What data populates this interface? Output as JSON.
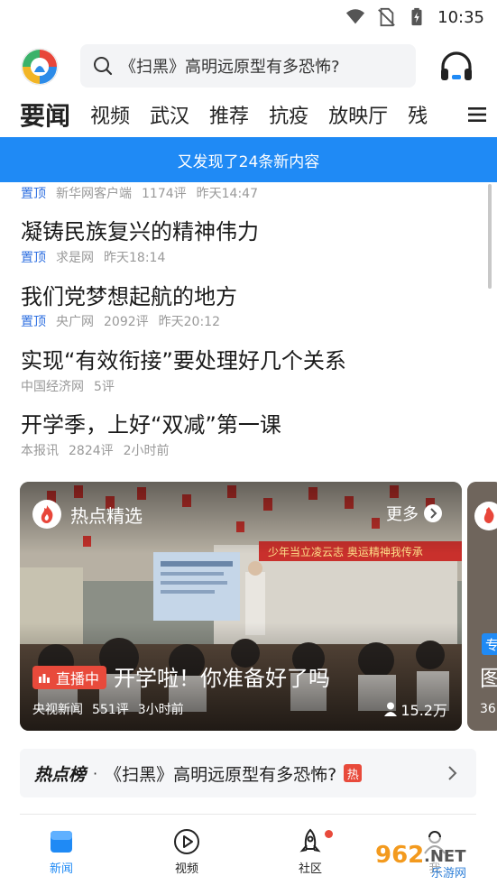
{
  "status_bar": {
    "time": "10:35"
  },
  "header": {
    "search_placeholder": "《扫黑》高明远原型有多恐怖?"
  },
  "channels": [
    "要闻",
    "视频",
    "武汉",
    "推荐",
    "抗疫",
    "放映厅",
    "残"
  ],
  "banner": {
    "text": "又发现了24条新内容"
  },
  "feed": {
    "top_meta": {
      "pin": "置顶",
      "source": "新华网客户端",
      "comments": "1174评",
      "time": "昨天14:47"
    },
    "items": [
      {
        "title": "凝铸民族复兴的精神伟力",
        "pin": "置顶",
        "source": "求是网",
        "comments": "",
        "time": "昨天18:14"
      },
      {
        "title": "我们党梦想起航的地方",
        "pin": "置顶",
        "source": "央广网",
        "comments": "2092评",
        "time": "昨天20:12"
      },
      {
        "title": "实现“有效衔接”要处理好几个关系",
        "pin": "",
        "source": "中国经济网",
        "comments": "5评",
        "time": ""
      },
      {
        "title": "开学季，上好“双减”第一课",
        "pin": "",
        "source": "本报讯",
        "comments": "2824评",
        "time": "2小时前"
      }
    ]
  },
  "card": {
    "section_title": "热点精选",
    "more_label": "更多",
    "live_badge": "直播中",
    "title": "开学啦！你准备好了吗",
    "source": "央视新闻",
    "comments": "551评",
    "time": "3小时前",
    "viewers": "15.2万",
    "scene_banner": "少年当立凌云志  奥运精神我传承",
    "peek_tag": "专",
    "peek_char": "图",
    "peek_num": "36"
  },
  "hot_list": {
    "label": "热点榜",
    "separator": "·",
    "text": "《扫黑》高明远原型有多恐怖?",
    "tag": "热"
  },
  "tabs": [
    {
      "label": "新闻",
      "active": true
    },
    {
      "label": "视频",
      "active": false
    },
    {
      "label": "社区",
      "active": false,
      "dot": true
    },
    {
      "label": "我",
      "active": false
    }
  ],
  "watermark": {
    "brand": "962",
    "suffix": ".NET",
    "sub": "乐游网"
  },
  "colors": {
    "accent": "#1f8af5",
    "hot": "#e84a3b",
    "pin": "#2e6fe0"
  }
}
